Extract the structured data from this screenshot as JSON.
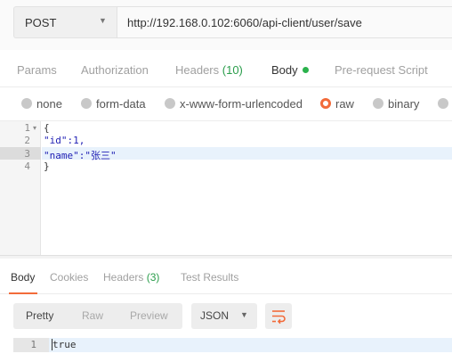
{
  "request": {
    "method": "POST",
    "url": "http://192.168.0.102:6060/api-client/user/save"
  },
  "request_tabs": {
    "params": "Params",
    "authorization": "Authorization",
    "headers": "Headers",
    "headers_count": "(10)",
    "body": "Body",
    "prerequest": "Pre-request Script"
  },
  "body_types": {
    "none": "none",
    "form_data": "form-data",
    "urlencoded": "x-www-form-urlencoded",
    "raw": "raw",
    "binary": "binary",
    "selected": "raw"
  },
  "editor": {
    "line_numbers": [
      "1",
      "2",
      "3",
      "4"
    ],
    "line1": "{",
    "line2": "\"id\":1,",
    "line3_key": "\"name\":",
    "line3_value": "\"张三\"",
    "line4": "}"
  },
  "response_tabs": {
    "body": "Body",
    "cookies": "Cookies",
    "headers": "Headers",
    "headers_count": "(3)",
    "test_results": "Test Results"
  },
  "view": {
    "pretty": "Pretty",
    "raw": "Raw",
    "preview": "Preview",
    "format": "JSON"
  },
  "response": {
    "line_number": "1",
    "text": "true"
  },
  "colors": {
    "accent": "#f26b3a",
    "status_green": "#2bb24c",
    "string_blue": "#1f1fb4"
  },
  "icons": {
    "method_caret": "▼",
    "fold_caret": "▾",
    "format_caret": "▼"
  }
}
